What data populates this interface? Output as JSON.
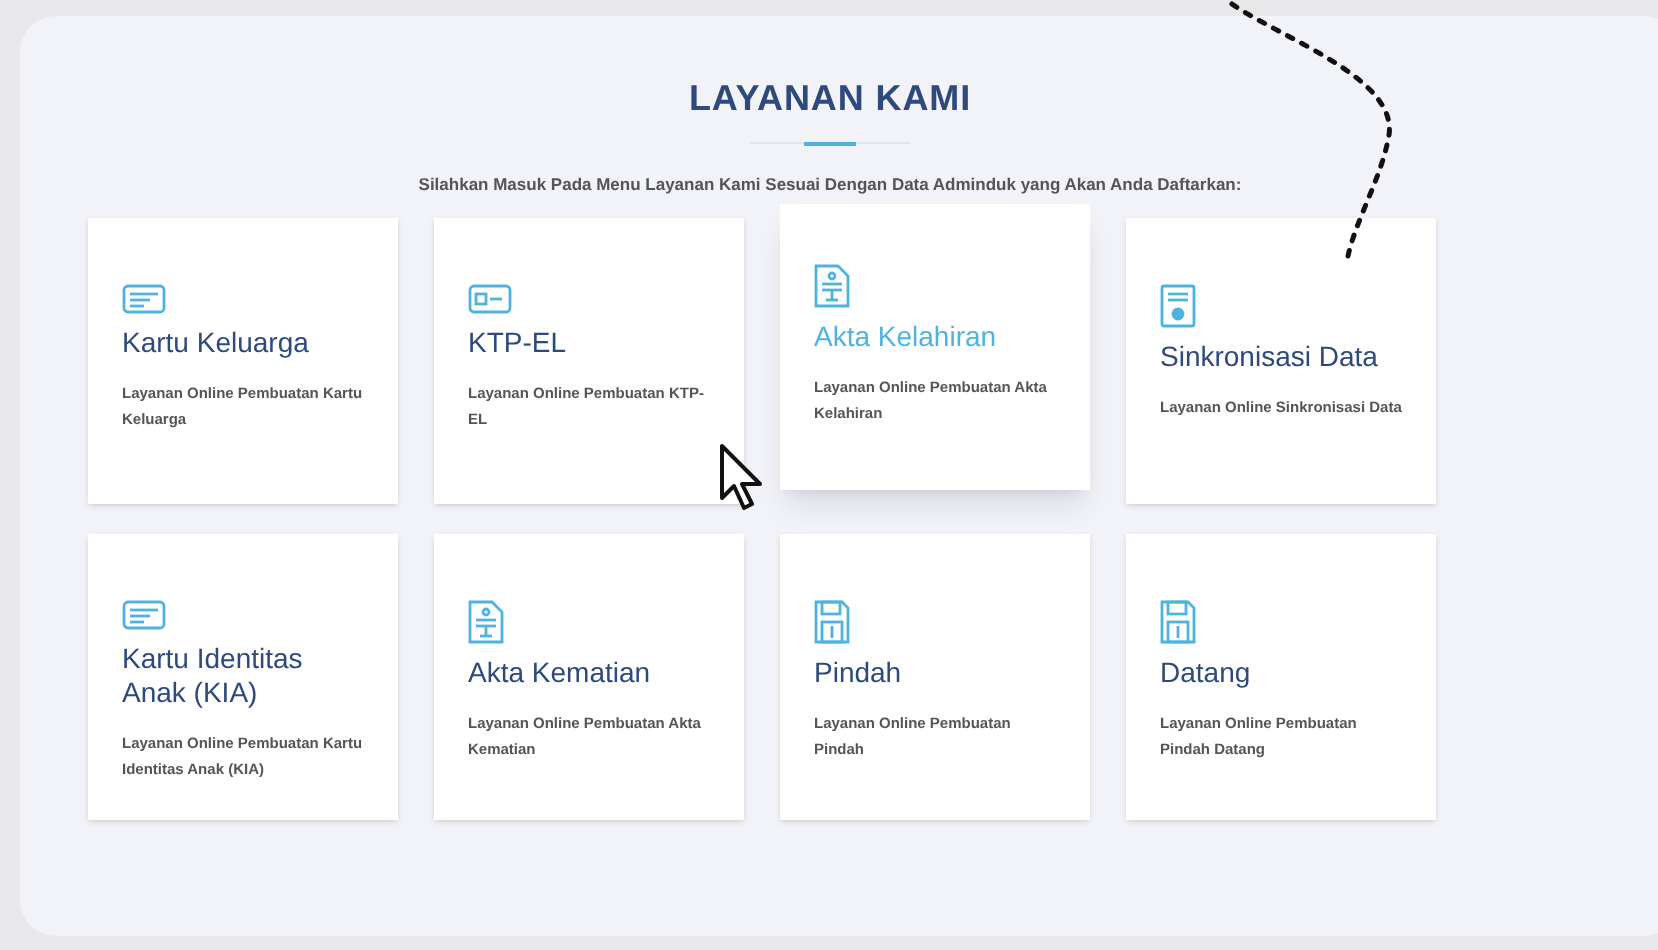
{
  "section": {
    "title": "LAYANAN KAMI",
    "subtitle": "Silahkan Masuk Pada Menu Layanan Kami Sesuai Dengan Data Adminduk yang Akan Anda Daftarkan:"
  },
  "services": [
    {
      "kind": "card",
      "title": "Kartu Keluarga",
      "description": "Layanan Online Pembuatan Kartu Keluarga",
      "hovered": false
    },
    {
      "kind": "idcard",
      "title": "KTP-EL",
      "description": "Layanan Online Pembuatan KTP-EL",
      "hovered": false
    },
    {
      "kind": "document",
      "title": "Akta Kelahiran",
      "description": "Layanan Online Pembuatan Akta Kelahiran",
      "hovered": true
    },
    {
      "kind": "certificate",
      "title": "Sinkronisasi Data",
      "description": "Layanan Online Sinkronisasi Data",
      "hovered": false
    },
    {
      "kind": "card",
      "title": "Kartu Identitas Anak (KIA)",
      "description": "Layanan Online Pembuatan Kartu Identitas Anak (KIA)",
      "hovered": false
    },
    {
      "kind": "document",
      "title": "Akta Kematian",
      "description": "Layanan Online Pembuatan Akta Kematian",
      "hovered": false
    },
    {
      "kind": "disk",
      "title": "Pindah",
      "description": "Layanan Online Pembuatan Pindah",
      "hovered": false
    },
    {
      "kind": "disk",
      "title": "Datang",
      "description": "Layanan Online Pembuatan Pindah Datang",
      "hovered": false
    }
  ]
}
